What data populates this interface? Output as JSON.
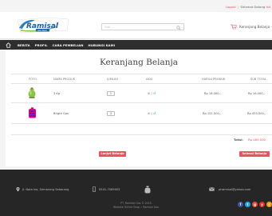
{
  "topbar": {
    "logout": "Logout",
    "separator": "|",
    "welcome_prefix": "Selamat Datang",
    "user": "Isd"
  },
  "header": {
    "logo_text": "Ramisal",
    "logo_subtext": "Gas Mart",
    "search": {
      "placeholder": "Cari ..."
    },
    "cart_label": "Keranjang Belanja -"
  },
  "nav": {
    "items": [
      "BERITA",
      "PROFIL",
      "CARA PEMBELIAN",
      "HUBUNGI KAMI"
    ]
  },
  "page": {
    "title": "Keranjang Belanja",
    "columns": [
      "FOTO",
      "NAMA PRODUK",
      "JUMLAH",
      "AKSI",
      "HARGA PRODUK",
      "SUB TOTAL"
    ],
    "rows": [
      {
        "name": "3 Kg",
        "qty": "1",
        "delete_glyph": "⊗",
        "edit_glyph": "↺",
        "price": "Rp 16.000,-",
        "subtotal": "Rp 16.000,-"
      },
      {
        "name": "Bright Gas",
        "qty": "3",
        "delete_glyph": "⊗",
        "edit_glyph": "↺",
        "price": "Rp 151.000,-",
        "subtotal": "Rp 453.000,-"
      }
    ],
    "total_label": "Total:",
    "total_value": "Rp 469.000",
    "continue_button": "Lanjut Belanja",
    "checkout_button": "Selesai Belanja"
  },
  "footer": {
    "address": "Jl. Nata Ivo, Semarang Sebarang",
    "phone": "0541-7089003",
    "email": "ptramisal@yahoo.com",
    "copyright_line1": "PT. Ramisal Gas © 2015",
    "copyright_line2": "Website Online Shop :: Ramisal Gas",
    "social": [
      "f",
      "t",
      "g",
      "y",
      "r"
    ],
    "social_colors": [
      "#3b5998",
      "#1da1f2",
      "#dd4b39",
      "#e52d27",
      "#f39c12"
    ]
  },
  "colors": {
    "accent": "#e8535f",
    "nav_bg": "#2e2e2e",
    "footer_bg": "#262626",
    "link_blue": "#2a8fd6"
  }
}
